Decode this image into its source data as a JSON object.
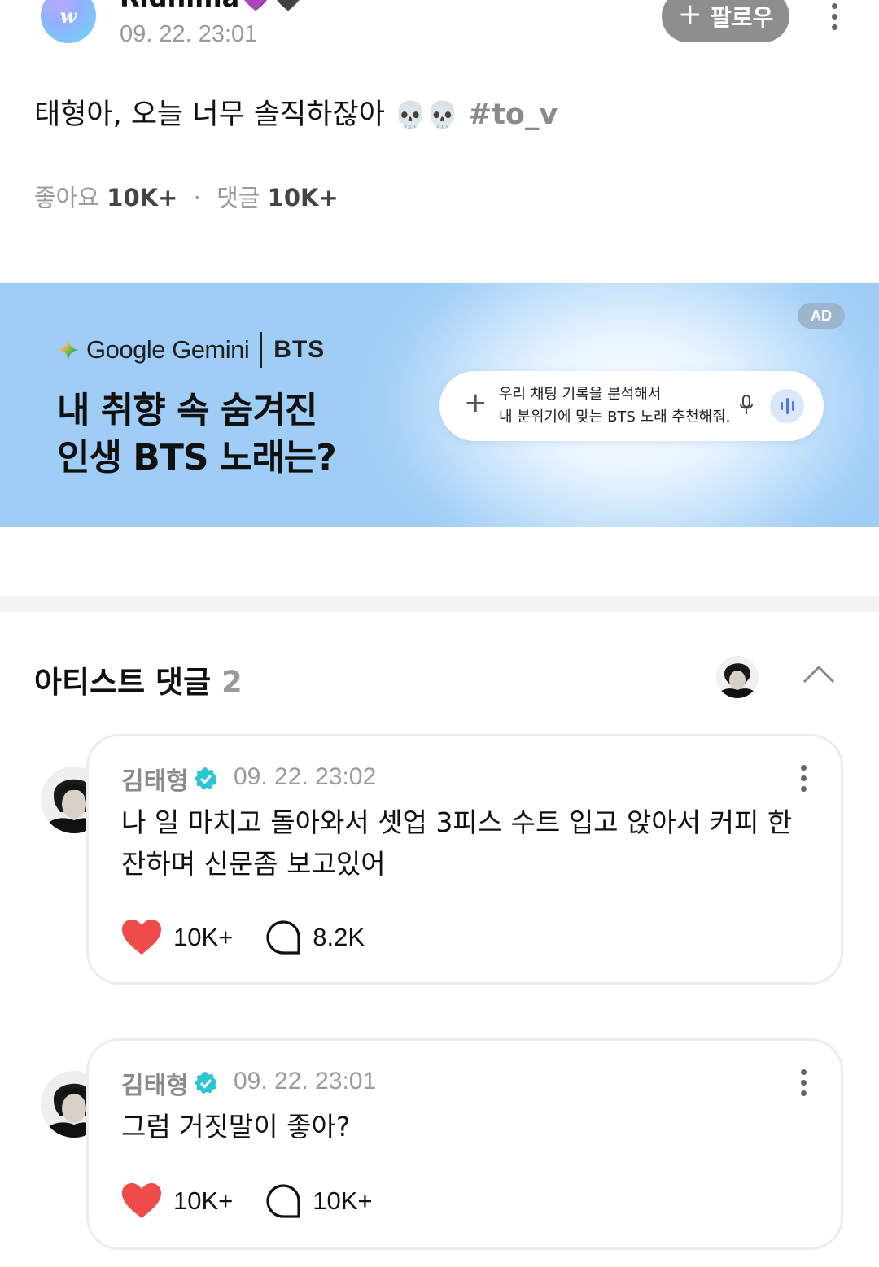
{
  "post": {
    "author": "Ridhima💜🖤",
    "avatar_initial": "w",
    "time": "09. 22. 23:01",
    "follow_label": "팔로우",
    "body": "태형아, 오늘 너무 솔직하잖아",
    "emojis": "💀💀",
    "hashtag": "#to_v",
    "likes_label": "좋아요",
    "likes_count": "10K+",
    "separator": "·",
    "comments_label": "댓글",
    "comments_count": "10K+"
  },
  "ad": {
    "badge": "AD",
    "brand": "Google Gemini",
    "partner": "BTS",
    "headline_line1": "내 취향 속 숨겨진",
    "headline_line2": "인생 BTS 노래는?",
    "prompt_line1": "우리 채팅 기록을 분석해서",
    "prompt_line2": "내 분위기에 맞는 BTS 노래 추천해줘."
  },
  "artist_comments": {
    "title": "아티스트 댓글",
    "count": "2",
    "items": [
      {
        "author": "김태형",
        "time": "09. 22. 23:02",
        "text": "나 일 마치고 돌아와서 셋업 3피스 수트 입고 앉아서 커피 한잔하며 신문좀 보고있어",
        "likes": "10K+",
        "replies": "8.2K"
      },
      {
        "author": "김태형",
        "time": "09. 22. 23:01",
        "text": "그럼 거짓말이 좋아?",
        "likes": "10K+",
        "replies": "10K+"
      }
    ]
  },
  "colors": {
    "accent_heart": "#f04b4b",
    "verified": "#2ec5d3",
    "ad_background": "#9fcdf6",
    "follow_button": "#8e8e8e"
  }
}
